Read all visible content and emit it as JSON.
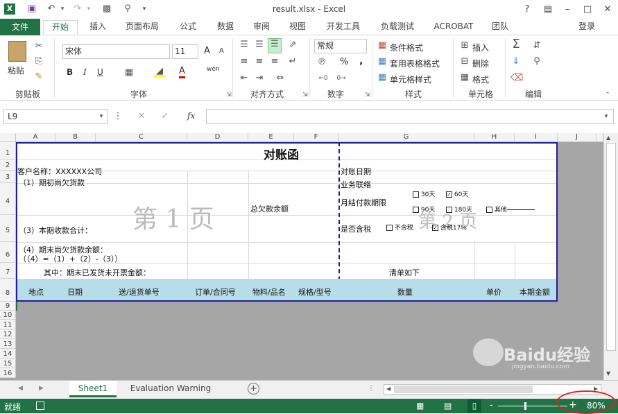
{
  "titlebar": {
    "title": "result.xlsx - Excel",
    "help": "?"
  },
  "tabs": {
    "file": "文件",
    "items": [
      "开始",
      "插入",
      "页面布局",
      "公式",
      "数据",
      "审阅",
      "视图",
      "开发工具",
      "负载测试",
      "ACROBAT",
      "团队"
    ],
    "login": "登录"
  },
  "ribbon": {
    "clipboard": {
      "paste": "粘贴",
      "label": "剪贴板"
    },
    "font": {
      "name": "宋体",
      "size": "11",
      "label": "字体",
      "bold": "B",
      "italic": "I",
      "underline": "U",
      "grow": "A",
      "shrink": "A",
      "font_color": "A",
      "phonetic": "wén"
    },
    "align": {
      "label": "对齐方式"
    },
    "number": {
      "format": "常规",
      "label": "数字",
      "percent": "%",
      "comma": ","
    },
    "styles": {
      "cond": "条件格式",
      "table": "套用表格格式",
      "cell": "单元格样式",
      "label": "样式"
    },
    "cells": {
      "insert": "插入",
      "delete": "删除",
      "format": "格式",
      "label": "单元格"
    },
    "editing": {
      "label": "编辑"
    }
  },
  "formula_bar": {
    "name_box": "L9",
    "fx": "fx"
  },
  "columns": [
    "A",
    "B",
    "C",
    "D",
    "E",
    "F",
    "G",
    "H",
    "I",
    "J"
  ],
  "rows": [
    "1",
    "2",
    "3",
    "4",
    "5",
    "6",
    "7",
    "8",
    "9",
    "10",
    "11",
    "12",
    "13",
    "14",
    "15",
    "16"
  ],
  "sheet": {
    "title": "对账函",
    "customer": "客户名称：XXXXXX公司",
    "prev_balance": "（1）期初尚欠货款",
    "total_owed": "总欠款余额",
    "recv_total": "（3）本期收款合计：",
    "end_balance": "（4）期末尚欠货款余额：",
    "formula": "（（4）=（1）+（2）-（3））",
    "unbilled": "其中：期末已发货未开票金额：",
    "recon_date": "对账日期",
    "contact": "业务联络",
    "pay_term": "月结付款期限",
    "opt30": "30天",
    "opt60": "60天",
    "opt90": "90天",
    "opt180": "180天",
    "opt_other": "其他",
    "tax": "是否含税",
    "no_tax": "不含税",
    "tax17": "含税17%",
    "list_title": "清单如下",
    "page1": "第 1 页",
    "page2": "第 2 页",
    "headers": [
      "地点",
      "日期",
      "送/退货单号",
      "订单/合同号",
      "物料/品名",
      "规格/型号",
      "数量",
      "单价",
      "本期金额"
    ]
  },
  "sheettabs": {
    "tabs": [
      "Sheet1",
      "Evaluation Warning"
    ],
    "add": "+"
  },
  "statusbar": {
    "ready": "就绪",
    "zoom": "80%",
    "minus": "-",
    "plus": "+"
  },
  "watermark": {
    "text": "Baidu经验",
    "url": "jingyan.baidu.com"
  },
  "colors": {
    "accent": "#217346",
    "sheet_border": "#1f1f9a",
    "header_fill": "#b7dde8"
  }
}
